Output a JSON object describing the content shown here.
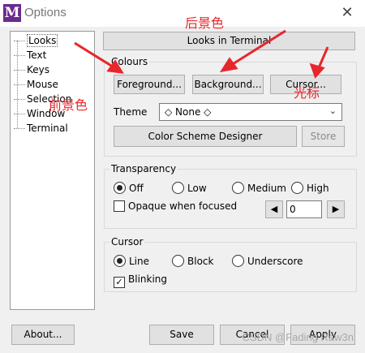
{
  "window": {
    "title": "Options",
    "app_icon_letter": "M"
  },
  "tree": {
    "items": [
      {
        "label": "Looks",
        "selected": true
      },
      {
        "label": "Text"
      },
      {
        "label": "Keys"
      },
      {
        "label": "Mouse"
      },
      {
        "label": "Selection"
      },
      {
        "label": "Window"
      },
      {
        "label": "Terminal"
      }
    ]
  },
  "header_button": "Looks in Terminal",
  "colours": {
    "title": "Colours",
    "foreground": "Foreground...",
    "background": "Background...",
    "cursor": "Cursor...",
    "theme_label": "Theme",
    "theme_value": "◇ None ◇",
    "designer": "Color Scheme Designer",
    "store": "Store"
  },
  "transparency": {
    "title": "Transparency",
    "options": [
      "Off",
      "Low",
      "Medium",
      "High"
    ],
    "selected": "Off",
    "opaque_label": "Opaque when focused",
    "opaque_checked": false,
    "value": "0"
  },
  "cursor": {
    "title": "Cursor",
    "options": [
      "Line",
      "Block",
      "Underscore"
    ],
    "selected": "Line",
    "blinking_label": "Blinking",
    "blinking_checked": true
  },
  "footer": {
    "about": "About...",
    "save": "Save",
    "cancel": "Cancel",
    "apply": "Apply"
  },
  "annotations": {
    "foreground": "前景色",
    "background": "后景色",
    "cursor": "光标",
    "color": "#e8262b"
  },
  "watermark": "CSDN @Fading Raw3n"
}
